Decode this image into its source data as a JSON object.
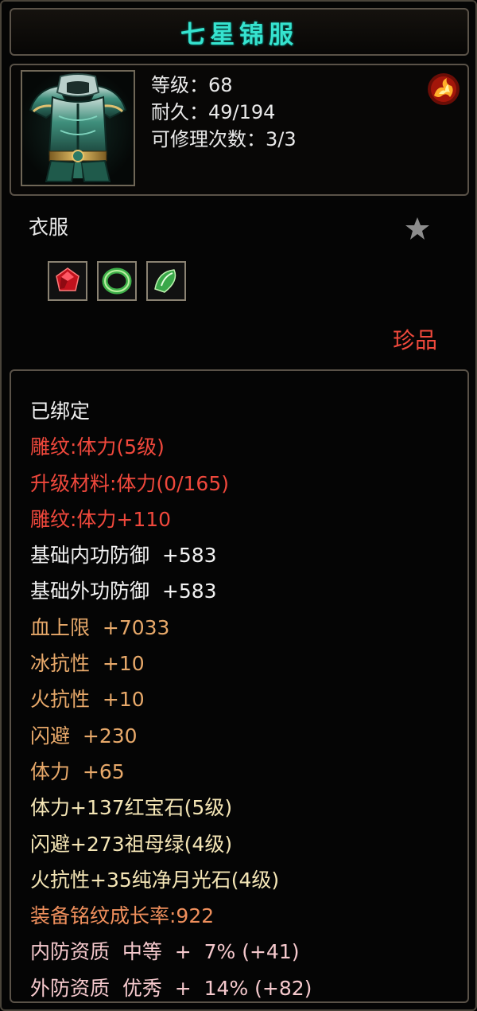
{
  "item": {
    "name": "七星锦服",
    "level_line": "等级：68",
    "durability_line": "耐久：49/194",
    "repair_line": "可修理次数：3/3",
    "type": "衣服",
    "rarity": "珍品"
  },
  "colors": {
    "title": "#36e3cf",
    "white": "#f2f2f2",
    "red": "#f0483c",
    "orange": "#e8a96a",
    "cream": "#f5e6b6",
    "salmon": "#ef8f5c",
    "pink": "#f6c9cd"
  },
  "icons": {
    "item": "armor-chest-icon",
    "fire": "fire-emblem-icon",
    "star": "star-icon",
    "slots": [
      "ruby-gem-icon",
      "jade-bangle-icon",
      "moonstone-gem-icon"
    ]
  },
  "attributes": [
    {
      "text": "已绑定",
      "color": "white"
    },
    {
      "text": "雕纹:体力(5级)",
      "color": "red"
    },
    {
      "text": "升级材料:体力(0/165)",
      "color": "red"
    },
    {
      "text": "雕纹:体力+110",
      "color": "red"
    },
    {
      "text": "基础内功防御  +583",
      "color": "white"
    },
    {
      "text": "基础外功防御  +583",
      "color": "white"
    },
    {
      "text": "血上限  +7033",
      "color": "orange"
    },
    {
      "text": "冰抗性  +10",
      "color": "orange"
    },
    {
      "text": "火抗性  +10",
      "color": "orange"
    },
    {
      "text": "闪避  +230",
      "color": "orange"
    },
    {
      "text": "体力  +65",
      "color": "orange"
    },
    {
      "text": "体力+137红宝石(5级)",
      "color": "cream"
    },
    {
      "text": "闪避+273祖母绿(4级)",
      "color": "cream"
    },
    {
      "text": "火抗性+35纯净月光石(4级)",
      "color": "cream"
    },
    {
      "text": "装备铭纹成长率:922",
      "color": "salmon"
    },
    {
      "text": "内防资质  中等  +  7% (+41)",
      "color": "pink"
    },
    {
      "text": "外防资质  优秀  +  14% (+82)",
      "color": "pink"
    }
  ]
}
